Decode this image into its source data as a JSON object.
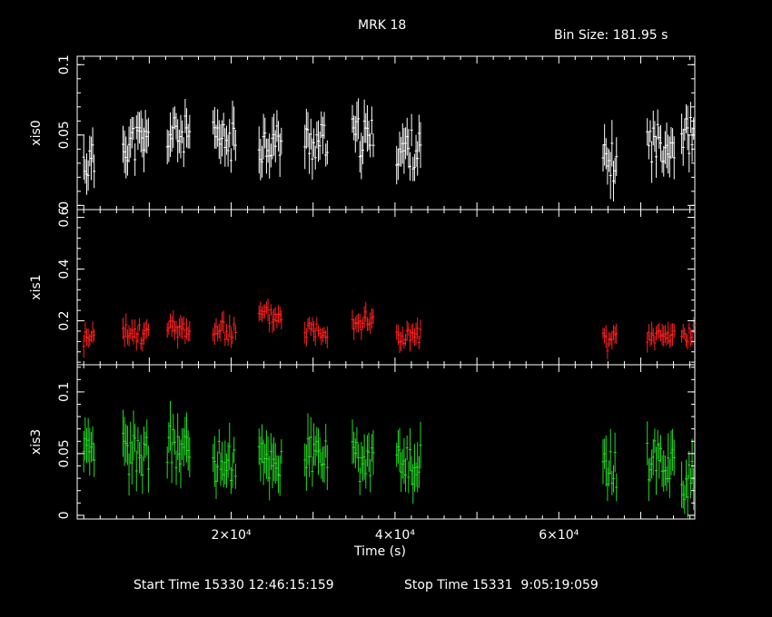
{
  "header": {
    "title": "MRK 18",
    "bin_size": "Bin Size: 181.95 s"
  },
  "footer": {
    "start": "Start Time 15330 12:46:15:159",
    "stop": "Stop Time 15331  9:05:19:059"
  },
  "chart_data": {
    "type": "scatter",
    "style": "light curve with vertical error bars, three stacked panels sharing the time axis",
    "xlabel": "Time (s)",
    "xlim": [
      1200,
      76600
    ],
    "xticks": [
      {
        "value": 20000,
        "label": "2×10⁴"
      },
      {
        "value": 40000,
        "label": "4×10⁴"
      },
      {
        "value": 60000,
        "label": "6×10⁴"
      }
    ],
    "segments": [
      [
        2000,
        3400
      ],
      [
        6800,
        10000
      ],
      [
        12200,
        15000
      ],
      [
        17800,
        20600
      ],
      [
        23400,
        26200
      ],
      [
        29000,
        31800
      ],
      [
        34800,
        37400
      ],
      [
        40200,
        43200
      ],
      [
        65400,
        67200
      ],
      [
        70800,
        74200
      ],
      [
        75000,
        76600
      ]
    ],
    "panels": [
      {
        "name": "xis0",
        "ylabel": "xis0",
        "color": "#ffffff",
        "ylim": [
          -0.003,
          0.106
        ],
        "yticks": [
          {
            "value": 0,
            "label": "0"
          },
          {
            "value": 0.05,
            "label": "0.05"
          },
          {
            "value": 0.1,
            "label": "0.1"
          }
        ],
        "base": 0.045,
        "segment_levels": [
          0.03,
          0.045,
          0.05,
          0.045,
          0.045,
          0.045,
          0.048,
          0.04,
          0.03,
          0.045,
          0.05
        ],
        "error": 0.013,
        "seed": 11
      },
      {
        "name": "xis1",
        "ylabel": "xis1",
        "color": "#ff2020",
        "ylim": [
          0.03,
          0.63
        ],
        "yticks": [
          {
            "value": 0.2,
            "label": "0.2"
          },
          {
            "value": 0.4,
            "label": "0.4"
          },
          {
            "value": 0.6,
            "label": "0.6"
          }
        ],
        "segment_levels": [
          0.13,
          0.15,
          0.17,
          0.16,
          0.22,
          0.17,
          0.2,
          0.14,
          0.12,
          0.14,
          0.15
        ],
        "error": 0.035,
        "seed": 23
      },
      {
        "name": "xis3",
        "ylabel": "xis3",
        "color": "#22dd22",
        "ylim": [
          -0.003,
          0.122
        ],
        "yticks": [
          {
            "value": 0,
            "label": "0"
          },
          {
            "value": 0.05,
            "label": "0.05"
          },
          {
            "value": 0.1,
            "label": "0.1"
          }
        ],
        "segment_levels": [
          0.045,
          0.05,
          0.055,
          0.045,
          0.045,
          0.05,
          0.045,
          0.04,
          0.035,
          0.045,
          0.03
        ],
        "error": 0.016,
        "seed": 37
      }
    ]
  }
}
